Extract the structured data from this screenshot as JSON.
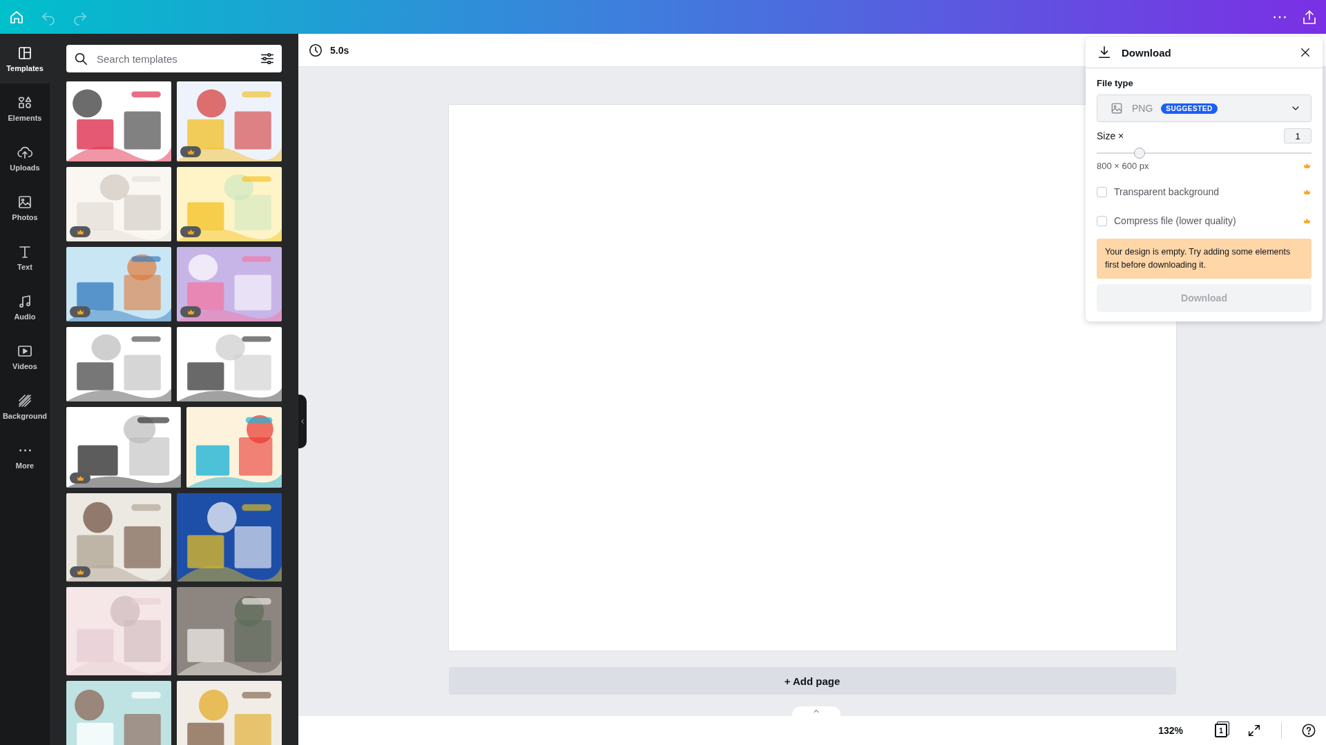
{
  "top_bar": {
    "undo": {
      "disabled": true
    },
    "redo": {
      "disabled": true
    }
  },
  "sidebar": {
    "items": [
      {
        "label": "Templates",
        "selected": true
      },
      {
        "label": "Elements",
        "selected": false
      },
      {
        "label": "Uploads",
        "selected": false
      },
      {
        "label": "Photos",
        "selected": false
      },
      {
        "label": "Text",
        "selected": false
      },
      {
        "label": "Audio",
        "selected": false
      },
      {
        "label": "Videos",
        "selected": false
      },
      {
        "label": "Background",
        "selected": false
      },
      {
        "label": "More",
        "selected": false
      }
    ]
  },
  "templates_panel": {
    "search": {
      "placeholder": "Search templates"
    },
    "thumbnails": [
      {
        "kind": "picture",
        "premium": false
      },
      {
        "kind": "picture",
        "premium": true
      },
      {
        "kind": "picture",
        "premium": true
      },
      {
        "kind": "picture",
        "premium": true
      },
      {
        "kind": "picture",
        "premium": true
      },
      {
        "kind": "picture",
        "premium": true
      },
      {
        "kind": "picture",
        "premium": false
      },
      {
        "kind": "picture",
        "premium": false
      },
      {
        "kind": "picture",
        "premium": true
      },
      {
        "kind": "picture",
        "premium": false
      },
      {
        "kind": "picture",
        "premium": true
      },
      {
        "kind": "picture",
        "premium": false
      },
      {
        "kind": "picture",
        "premium": false
      },
      {
        "kind": "picture",
        "premium": false
      },
      {
        "kind": "picture",
        "premium": false
      },
      {
        "kind": "picture",
        "premium": false
      }
    ]
  },
  "canvas": {
    "duration": "5.0s",
    "add_page": "+ Add page"
  },
  "download_panel": {
    "title": "Download",
    "file_type_label": "File type",
    "file_type": "PNG",
    "badge": "SUGGESTED",
    "size_label": "Size ×",
    "size_value": "1",
    "size_slider": {
      "level": 0.2
    },
    "dimensions": "800 × 600 px",
    "options": [
      {
        "label": "Transparent background",
        "checked": false
      },
      {
        "label": "Compress file (lower quality)",
        "checked": false
      }
    ],
    "warning": "Your design is empty. Try adding some elements first before downloading it.",
    "download_button": {
      "label": "Download",
      "disabled": true
    }
  },
  "status_bar": {
    "zoom": "132%",
    "page_count": "1"
  }
}
